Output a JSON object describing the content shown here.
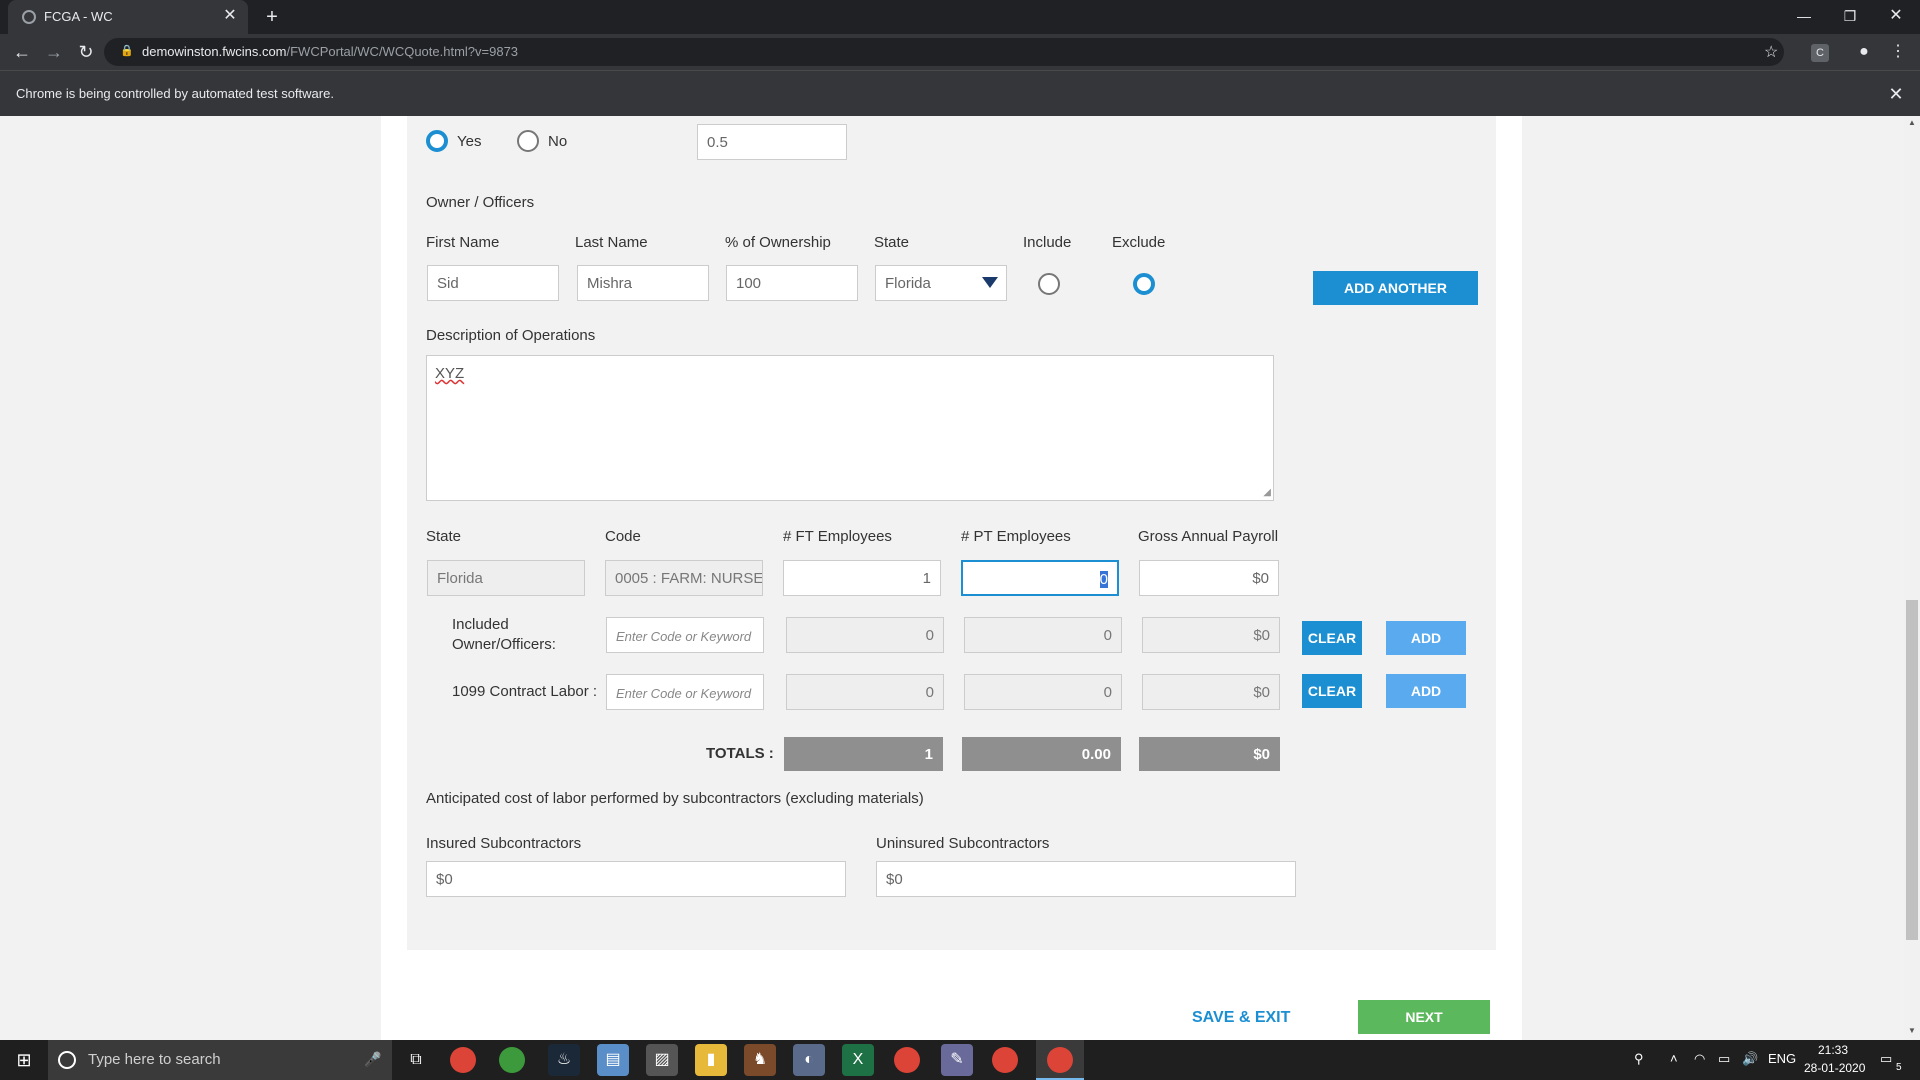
{
  "browser": {
    "tab_title": "FCGA - WC",
    "url_host": "demowinston.fwcins.com",
    "url_path": "/FWCPortal/WC/WCQuote.html?v=9873",
    "infobar_text": "Chrome is being controlled by automated test software.",
    "profile_letter": "C"
  },
  "top_row": {
    "yes_label": "Yes",
    "no_label": "No",
    "value": "0.5"
  },
  "owners": {
    "section_title": "Owner / Officers",
    "first_name_label": "First Name",
    "last_name_label": "Last Name",
    "ownership_label": "% of Ownership",
    "state_label": "State",
    "include_label": "Include",
    "exclude_label": "Exclude",
    "first_name": "Sid",
    "last_name": "Mishra",
    "ownership": "100",
    "state": "Florida",
    "add_another": "ADD ANOTHER"
  },
  "description": {
    "label": "Description of Operations",
    "value": "XYZ"
  },
  "class_table": {
    "headers": {
      "state": "State",
      "code": "Code",
      "ft": "# FT Employees",
      "pt": "# PT Employees",
      "payroll": "Gross Annual Payroll"
    },
    "main_row": {
      "state": "Florida",
      "code": "0005 : FARM: NURSE",
      "ft": "1",
      "pt": "0",
      "payroll": "$0"
    },
    "included_row": {
      "label_line1": "Included",
      "label_line2": "Owner/Officers:",
      "code_placeholder": "Enter Code or Keyword",
      "ft": "0",
      "pt": "0",
      "payroll": "$0",
      "clear": "CLEAR",
      "add": "ADD"
    },
    "contract_row": {
      "label": "1099 Contract Labor :",
      "code_placeholder": "Enter Code or Keyword",
      "ft": "0",
      "pt": "0",
      "payroll": "$0",
      "clear": "CLEAR",
      "add": "ADD"
    },
    "totals": {
      "label": "TOTALS :",
      "ft": "1",
      "pt": "0.00",
      "payroll": "$0"
    }
  },
  "subcontractors": {
    "heading": "Anticipated cost of labor performed by subcontractors (excluding materials)",
    "insured_label": "Insured Subcontractors",
    "insured_value": "$0",
    "uninsured_label": "Uninsured Subcontractors",
    "uninsured_value": "$0"
  },
  "footer_actions": {
    "save_exit": "SAVE & EXIT",
    "next": "NEXT"
  },
  "taskbar": {
    "search_placeholder": "Type here to search",
    "language": "ENG",
    "time": "21:33",
    "date": "28-01-2020",
    "notification_count": "5"
  },
  "colors": {
    "accent_blue": "#1b8fd2",
    "light_blue": "#5aaaf0",
    "next_green": "#5cb85c",
    "totals_gray": "#8f8f8f"
  }
}
